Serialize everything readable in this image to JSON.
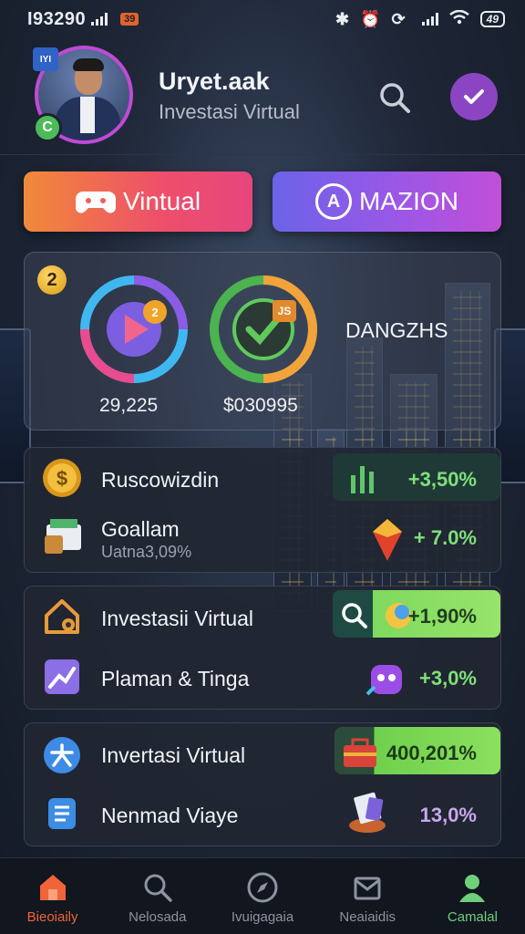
{
  "status_bar": {
    "time": "I93290",
    "notification_badge": "39",
    "battery": "49"
  },
  "profile": {
    "flag_text": "IYI",
    "badge_text": "C",
    "name": "Uryet.aak",
    "subtitle": "Investasi Virtual"
  },
  "actions": {
    "virtual_label": "Vintual",
    "mazion_label": "MAZION",
    "mazion_icon_text": "A"
  },
  "stats": {
    "badge": "2",
    "ring1": {
      "value": "29,225",
      "badge": "2"
    },
    "ring2": {
      "value": "$030995",
      "badge": "JS"
    },
    "title": "DANGZHS"
  },
  "card1": {
    "rows": [
      {
        "label": "Ruscowizdin",
        "value": "+3,50%"
      },
      {
        "label": "Goallam",
        "sublabel": "Uatna3,09%",
        "value": "+ 7.0%"
      }
    ]
  },
  "card2": {
    "rows": [
      {
        "label": "Investasii Virtual",
        "value": "+1,90%"
      },
      {
        "label": "Plaman & Tinga",
        "value": "+3,0%"
      }
    ]
  },
  "card3": {
    "rows": [
      {
        "label": "Invertasi Virtual",
        "value": "400,201%"
      },
      {
        "label": "Nenmad Viaye",
        "value": "13,0%"
      }
    ]
  },
  "nav": {
    "items": [
      {
        "label": "Bieoiaily"
      },
      {
        "label": "Nelosada"
      },
      {
        "label": "Ivuigagaia"
      },
      {
        "label": "Neaiaidis"
      },
      {
        "label": "Camalal"
      }
    ]
  },
  "colors": {
    "accent_purple": "#8b45c2",
    "positive_green": "#6fd07a",
    "highlight_green": "#8fe06a",
    "nav_active": "#f0643a",
    "neutral_value": "#c9a6ef"
  }
}
